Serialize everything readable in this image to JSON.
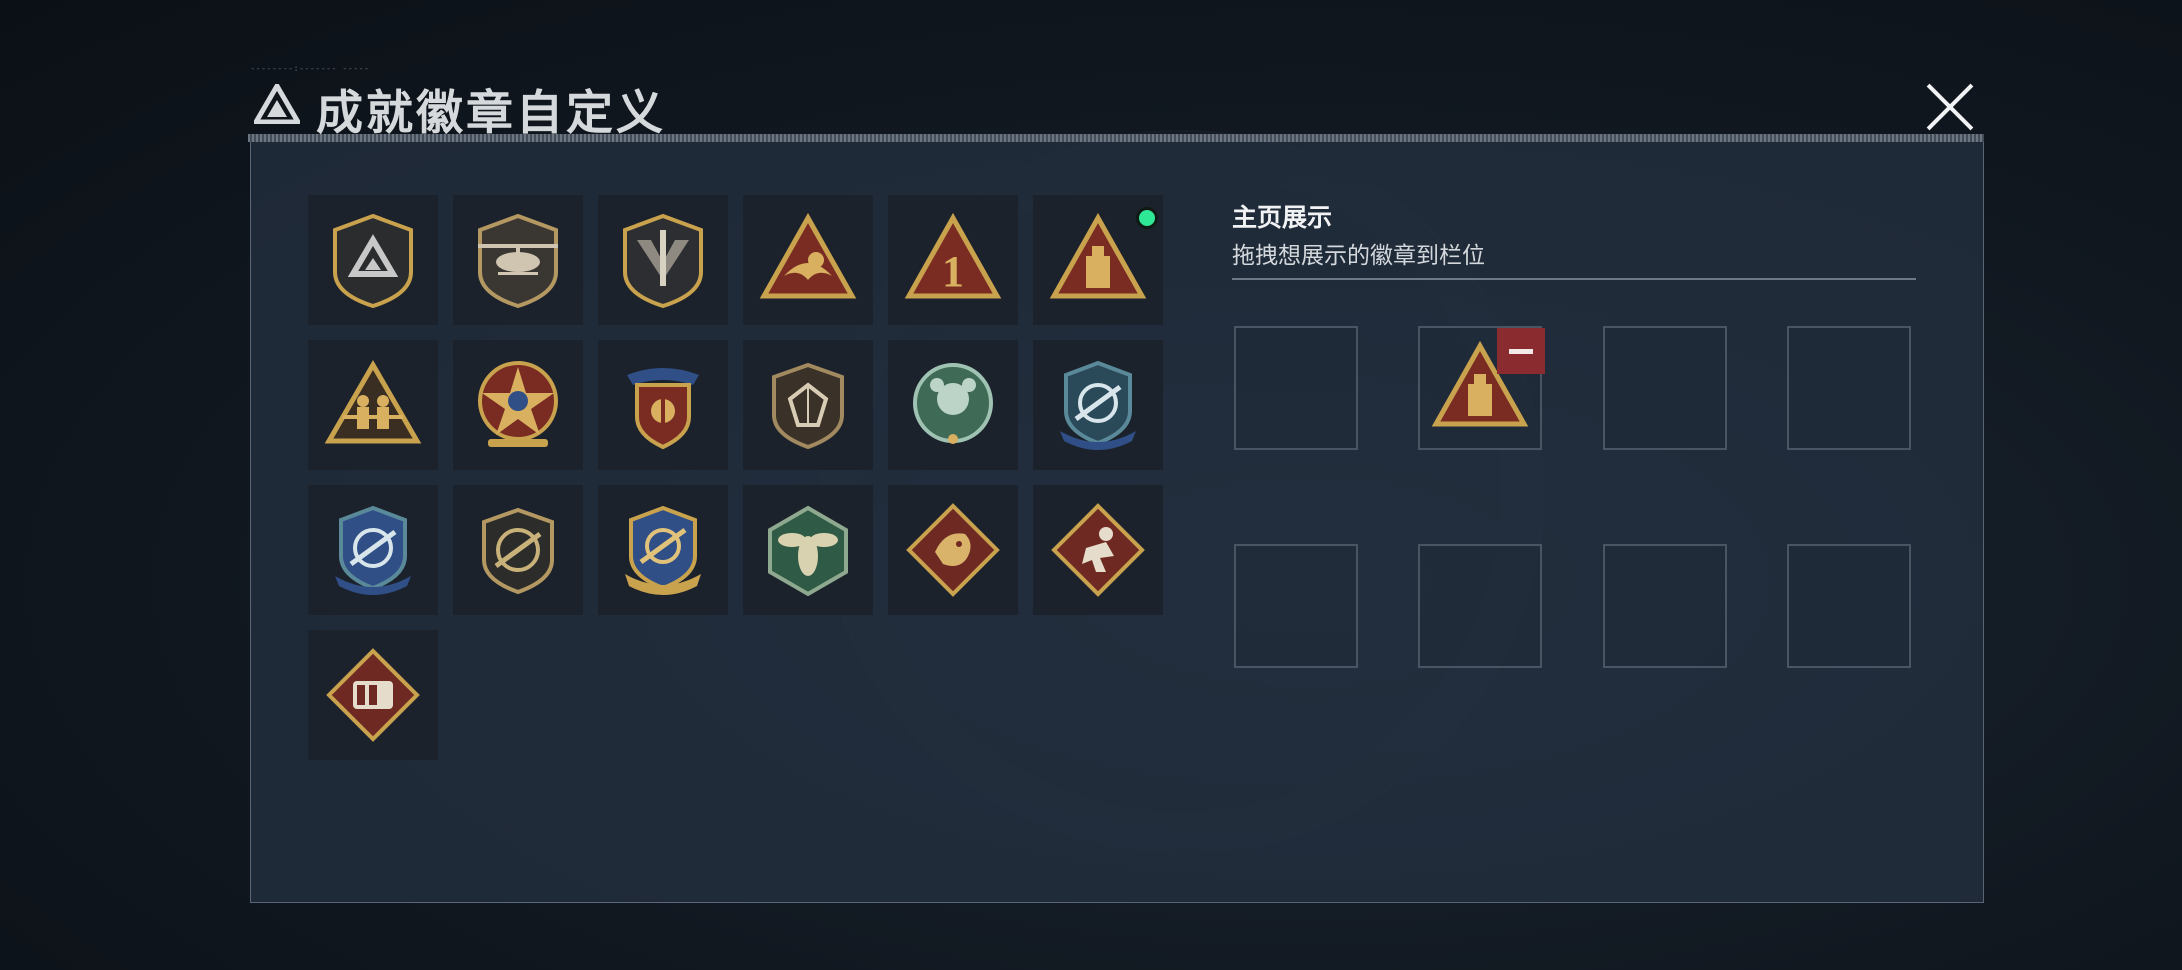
{
  "header": {
    "title": "成就徽章自定义",
    "tiny_text": "--------:------- -----",
    "logo_icon": "triangle-logo-icon",
    "close_icon": "close-icon"
  },
  "badges": [
    {
      "icon": "shield-delta-logo-icon"
    },
    {
      "icon": "helicopter-shield-icon"
    },
    {
      "icon": "dagger-shield-icon"
    },
    {
      "icon": "eagle-triangle-icon"
    },
    {
      "icon": "number-one-triangle-icon",
      "label": "1"
    },
    {
      "icon": "drive-triangle-icon",
      "is_new": true
    },
    {
      "icon": "soldiers-triangle-icon"
    },
    {
      "icon": "skull-star-medal-icon"
    },
    {
      "icon": "winged-shield-icon"
    },
    {
      "icon": "gem-shield-icon"
    },
    {
      "icon": "beast-green-medal-icon"
    },
    {
      "icon": "rifle-crosshair-shield-blue-icon"
    },
    {
      "icon": "rifle-crosshair-shield-blue-2-icon"
    },
    {
      "icon": "rifle-circle-shield-icon"
    },
    {
      "icon": "rifle-crosshair-shield-gold-icon"
    },
    {
      "icon": "hornet-hexagon-icon"
    },
    {
      "icon": "dragon-diamond-icon"
    },
    {
      "icon": "runner-diamond-icon"
    },
    {
      "icon": "fist-diamond-icon"
    }
  ],
  "display": {
    "title": "主页展示",
    "subtitle": "拖拽想展示的徽章到栏位",
    "slots": [
      {
        "badge": null
      },
      {
        "badge": "drive-triangle-icon",
        "removable": true
      },
      {
        "badge": null
      },
      {
        "badge": null
      },
      {
        "badge": null
      },
      {
        "badge": null
      },
      {
        "badge": null
      },
      {
        "badge": null
      }
    ]
  },
  "colors": {
    "accent_new": "#2ee896",
    "remove": "#8a2c2f",
    "gold": "#c9a24e",
    "badge_red": "#7a2b22",
    "badge_green": "#3f6a55",
    "badge_blue": "#2f4f86"
  }
}
